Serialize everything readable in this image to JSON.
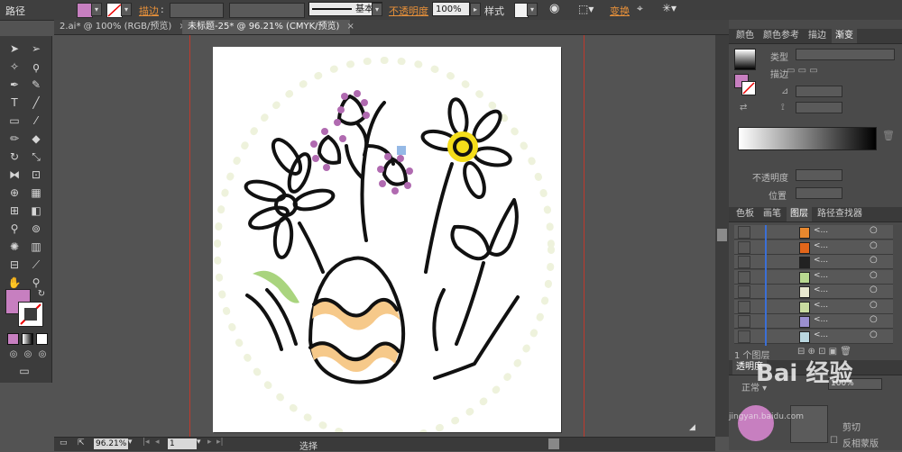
{
  "control_bar": {
    "selection_label": "路径",
    "stroke_label": "描边",
    "stroke_style": "基本",
    "opacity_label": "不透明度",
    "opacity_value": "100%",
    "style_label": "样式",
    "transform_label": "变换",
    "fill_color": "#c77fc0"
  },
  "tabs": [
    {
      "label": "2.ai* @ 100% (RGB/预览)",
      "active": false
    },
    {
      "label": "未标题-25* @ 96.21% (CMYK/预览)",
      "active": true
    }
  ],
  "right_panel": {
    "top_tabs": [
      "颜色",
      "颜色参考",
      "描边",
      "渐变"
    ],
    "gradient": {
      "type_label": "类型",
      "stroke_label": "描边",
      "opacity_label": "不透明度",
      "position_label": "位置"
    },
    "layer_tabs": [
      "色板",
      "画笔",
      "图层",
      "路径查找器"
    ],
    "layer_items": [
      {
        "label": "<...",
        "thumb": "#e8882e"
      },
      {
        "label": "<...",
        "thumb": "#e2661a"
      },
      {
        "label": "<...",
        "thumb": "#222222"
      },
      {
        "label": "<...",
        "thumb": "#b8d890"
      },
      {
        "label": "<...",
        "thumb": "#e8e8d0"
      },
      {
        "label": "<...",
        "thumb": "#c9dca0"
      },
      {
        "label": "<...",
        "thumb": "#9b8fcf"
      },
      {
        "label": "<...",
        "thumb": "#b9d6df"
      }
    ],
    "layer_count": "1 个图层",
    "transparency_label": "透明度",
    "transparency_value": "100%",
    "clip_label": "剪切",
    "invert_mask_label": "反相蒙版"
  },
  "status_bar": {
    "zoom": "96.21%",
    "page": "1",
    "tool": "选择"
  },
  "watermark": {
    "text": "Bai 经验",
    "sub": "jingyan.baidu.com"
  },
  "colors": {
    "accent_fill": "#c77fc0",
    "flower_center": "#f4dd1a",
    "bud_dots": "#b06ab0",
    "egg_stripes": "#f6c98a",
    "leaf_green": "#a9d47e",
    "dot_ring": "#eef2dc"
  }
}
